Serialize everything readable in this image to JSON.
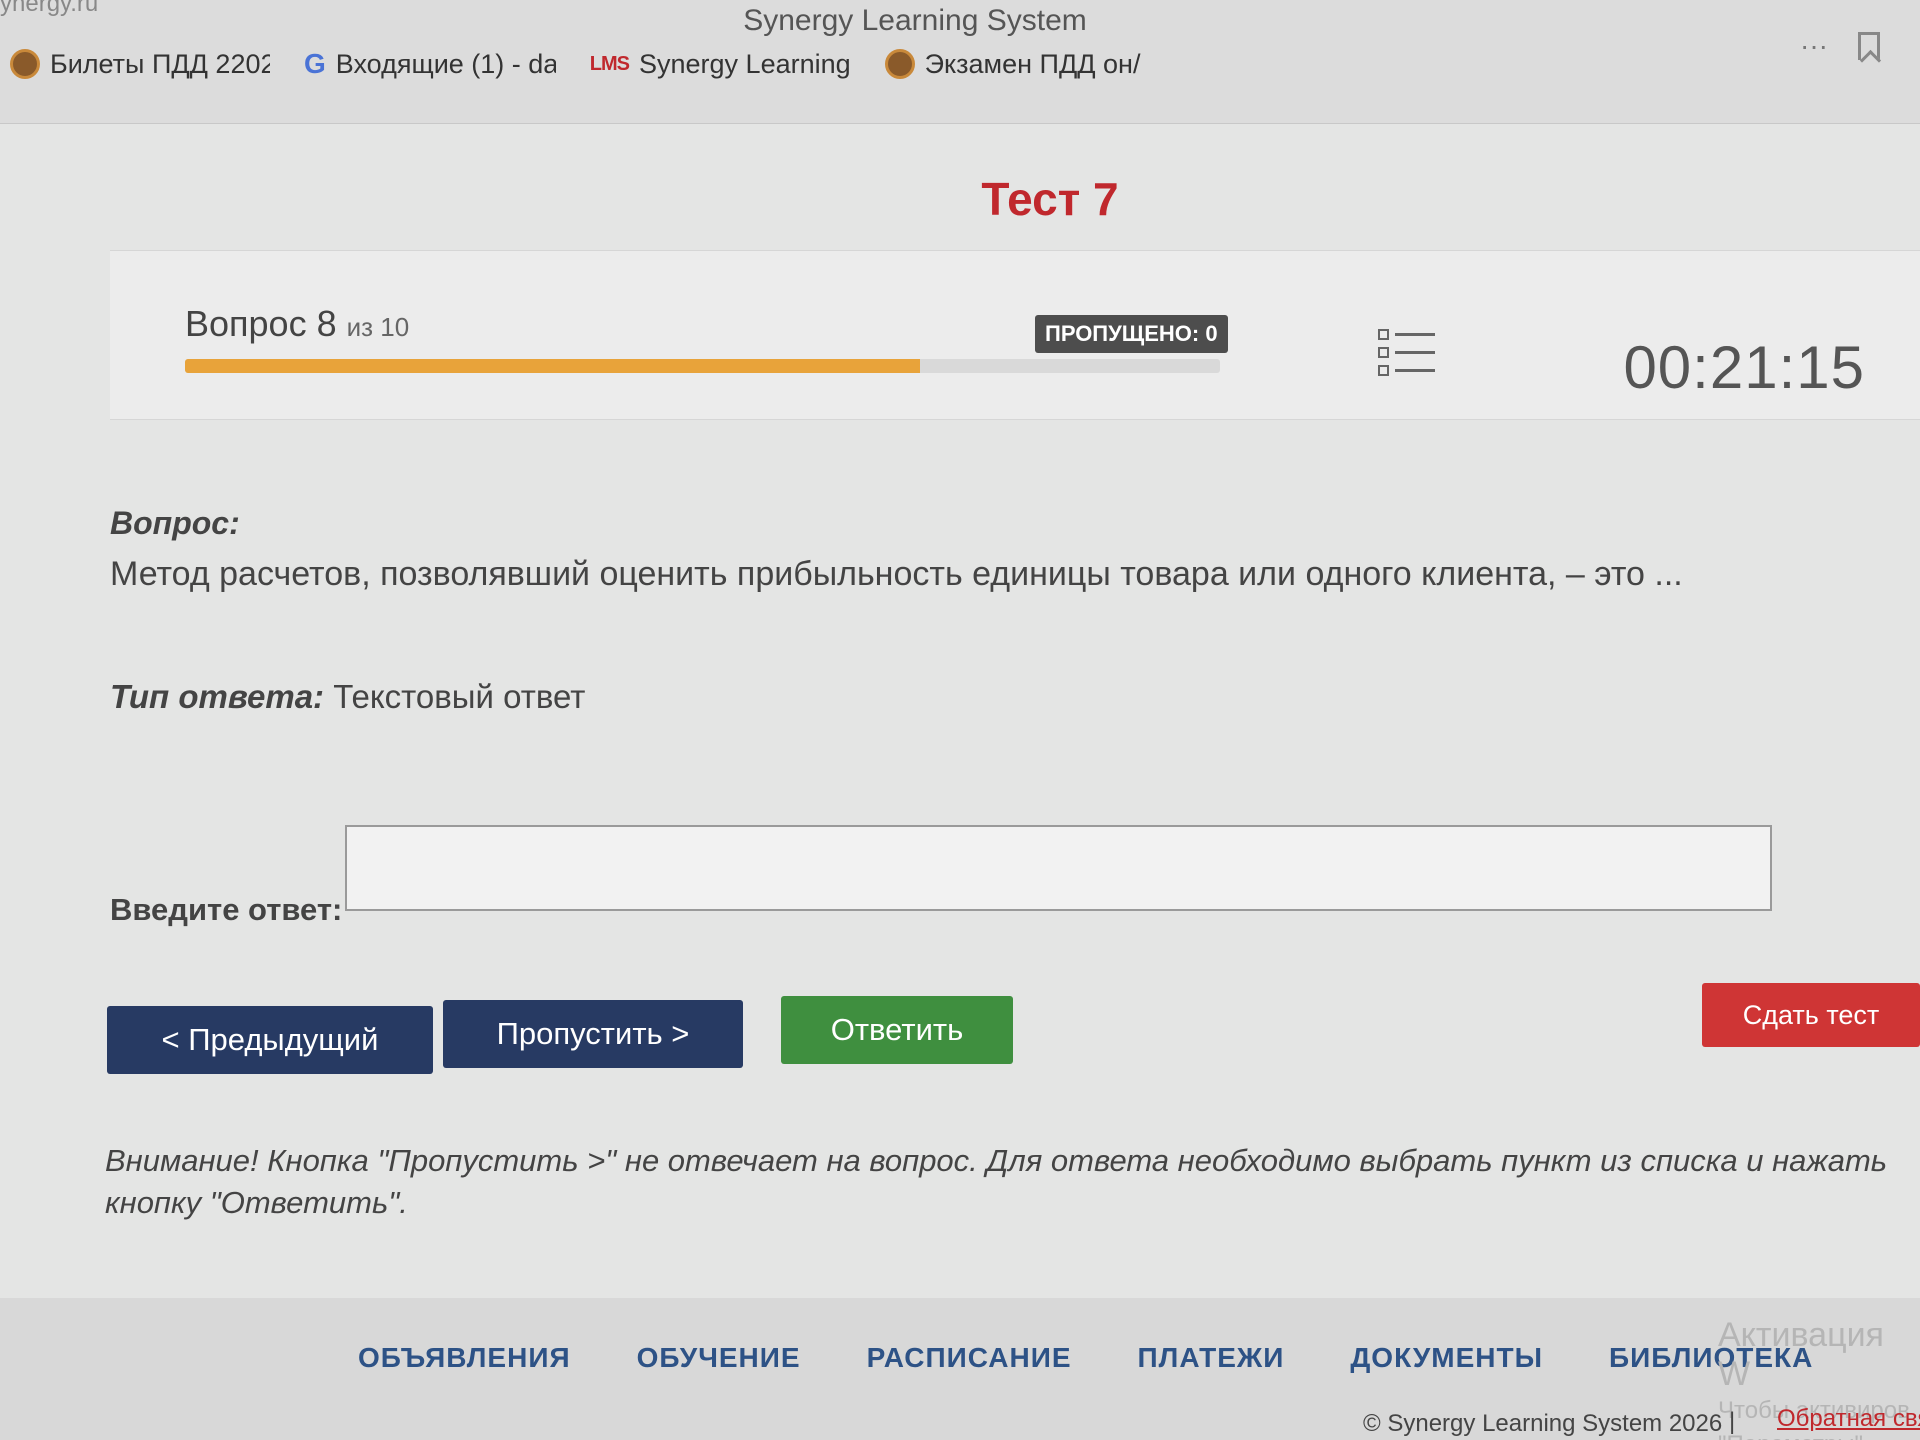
{
  "browser": {
    "site_fragment": "ynergy.ru",
    "window_title": "Synergy Learning System",
    "more_label": "···",
    "bookmarks": [
      {
        "label": "Билеты ПДД 2202"
      },
      {
        "label": "Входящие (1) - da"
      },
      {
        "label": "Synergy Learning"
      },
      {
        "label": "Экзамен ПДД он/"
      }
    ],
    "lms_icon_text": "LMS",
    "g_icon_text": "G"
  },
  "page": {
    "title": "Тест 7"
  },
  "status": {
    "question_label": "Вопрос 8",
    "question_total": "из 10",
    "progress_percent": 71,
    "skipped_label": "ПРОПУЩЕНО: 0",
    "timer": "00:21:15"
  },
  "question": {
    "label": "Вопрос:",
    "text": "Метод расчетов, позволявший оценить прибыльность единицы товара или одного клиента, – это ...",
    "type_label": "Тип ответа:",
    "type_value": " Текстовый ответ"
  },
  "answer": {
    "label": "Введите ответ:",
    "value": ""
  },
  "buttons": {
    "prev": "< Предыдущий",
    "skip": "Пропустить >",
    "answer": "Ответить",
    "submit": "Сдать тест"
  },
  "warning": "Внимание! Кнопка \"Пропустить >\" не отвечает на вопрос. Для ответа необходимо выбрать пункт из списка и нажать кнопку \"Ответить\".",
  "footer": {
    "nav": [
      "ОБЪЯВЛЕНИЯ",
      "ОБУЧЕНИЕ",
      "РАСПИСАНИЕ",
      "ПЛАТЕЖИ",
      "ДОКУМЕНТЫ",
      "БИБЛИОТЕКА"
    ],
    "activation_title": "Активация W",
    "activation_line1": "Чтобы активиров",
    "activation_line2": "\"Параметры\".",
    "copyright": "© Synergy Learning System 2026",
    "separator": "|",
    "feedback": "Обратная связь"
  }
}
